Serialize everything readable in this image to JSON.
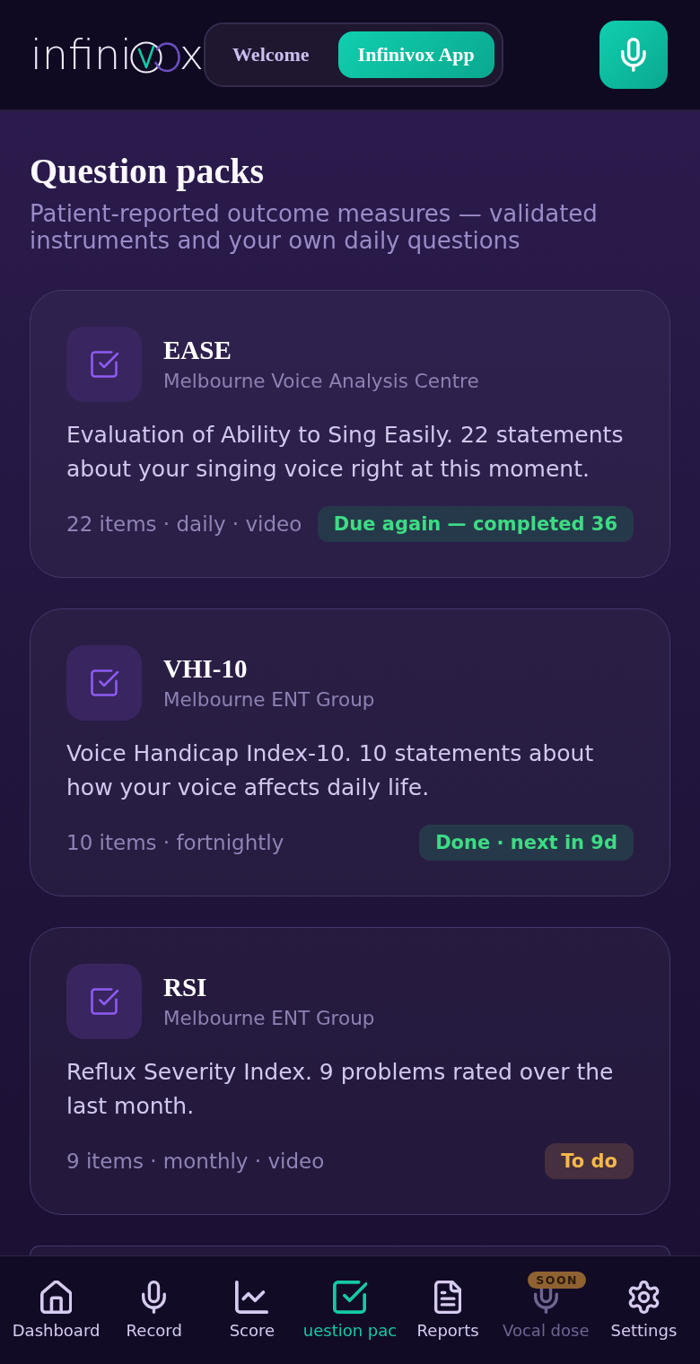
{
  "header": {
    "logo": {
      "text_start": "infini",
      "text_end": "x"
    },
    "tabs": [
      {
        "label": "Welcome",
        "selected": false
      },
      {
        "label": "Infinivox App",
        "selected": true
      }
    ]
  },
  "page": {
    "title": "Question packs",
    "subtitle": "Patient-reported outcome measures — validated instruments and your own daily questions"
  },
  "packs": [
    {
      "name": "EASE",
      "source": "Melbourne Voice Analysis Centre",
      "description": "Evaluation of Ability to Sing Easily. 22 statements about your singing voice right at this moment.",
      "meta": "22 items · daily · video",
      "status": {
        "label": "Due again — completed 36",
        "kind": "due"
      }
    },
    {
      "name": "VHI-10",
      "source": "Melbourne ENT Group",
      "description": "Voice Handicap Index-10. 10 statements about how your voice affects daily life.",
      "meta": "10 items · fortnightly",
      "status": {
        "label": "Done · next in 9d",
        "kind": "done"
      }
    },
    {
      "name": "RSI",
      "source": "Melbourne ENT Group",
      "description": "Reflux Severity Index. 9 problems rated over the last month.",
      "meta": "9 items · monthly · video",
      "status": {
        "label": "To do",
        "kind": "todo"
      }
    }
  ],
  "nav": [
    {
      "label": "Dashboard",
      "selected": false,
      "disabled": false
    },
    {
      "label": "Record",
      "selected": false,
      "disabled": false
    },
    {
      "label": "Score",
      "selected": false,
      "disabled": false
    },
    {
      "label": "uestion pac",
      "selected": true,
      "disabled": false
    },
    {
      "label": "Reports",
      "selected": false,
      "disabled": false
    },
    {
      "label": "Vocal dose",
      "selected": false,
      "disabled": true,
      "badge": "SOON"
    },
    {
      "label": "Settings",
      "selected": false,
      "disabled": false
    }
  ]
}
